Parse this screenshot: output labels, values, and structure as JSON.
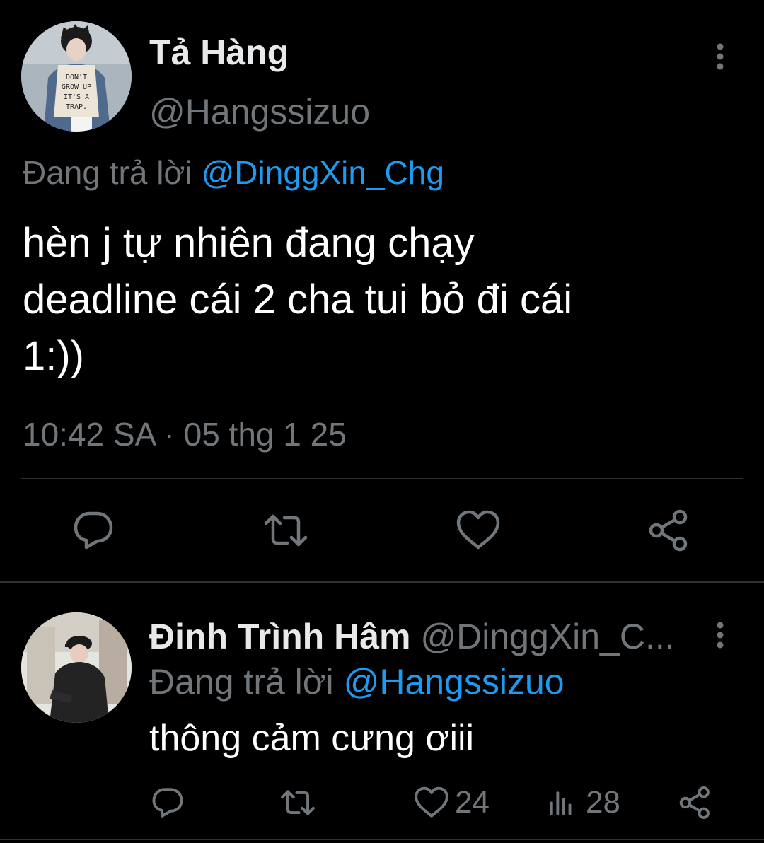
{
  "colors": {
    "background": "#000000",
    "text_primary": "#e7e9ea",
    "text_secondary": "#71767b",
    "accent": "#1d9bf0",
    "divider": "#2f3336"
  },
  "main_tweet": {
    "display_name": "Tả Hàng",
    "handle": "@Hangssizuo",
    "avatar_shirt_text": [
      "DON'T",
      "GROW UP",
      "IT'S A",
      "TRAP."
    ],
    "replying_prefix": "Đang trả lời",
    "replying_to": "@DinggXin_Chg",
    "text_lines": [
      "hèn j tự nhiên đang chạy",
      "deadline cái 2 cha tui bỏ đi cái",
      "1:))"
    ],
    "time": "10:42 SA",
    "separator": "·",
    "date": "05 thg 1 25",
    "actions": [
      "reply-icon",
      "retweet-icon",
      "like-icon",
      "share-icon"
    ],
    "more_icon": "more-vertical-icon"
  },
  "reply_tweet": {
    "display_name": "Đinh Trình Hâm",
    "handle": "@DinggXin_C...",
    "replying_prefix": "Đang trả lời",
    "replying_to": "@Hangssizuo",
    "text": "thông cảm cưng ơiii",
    "likes": "24",
    "views": "28",
    "actions": [
      "reply-icon",
      "retweet-icon",
      "like-icon",
      "views-icon",
      "share-icon"
    ],
    "more_icon": "more-vertical-icon"
  }
}
